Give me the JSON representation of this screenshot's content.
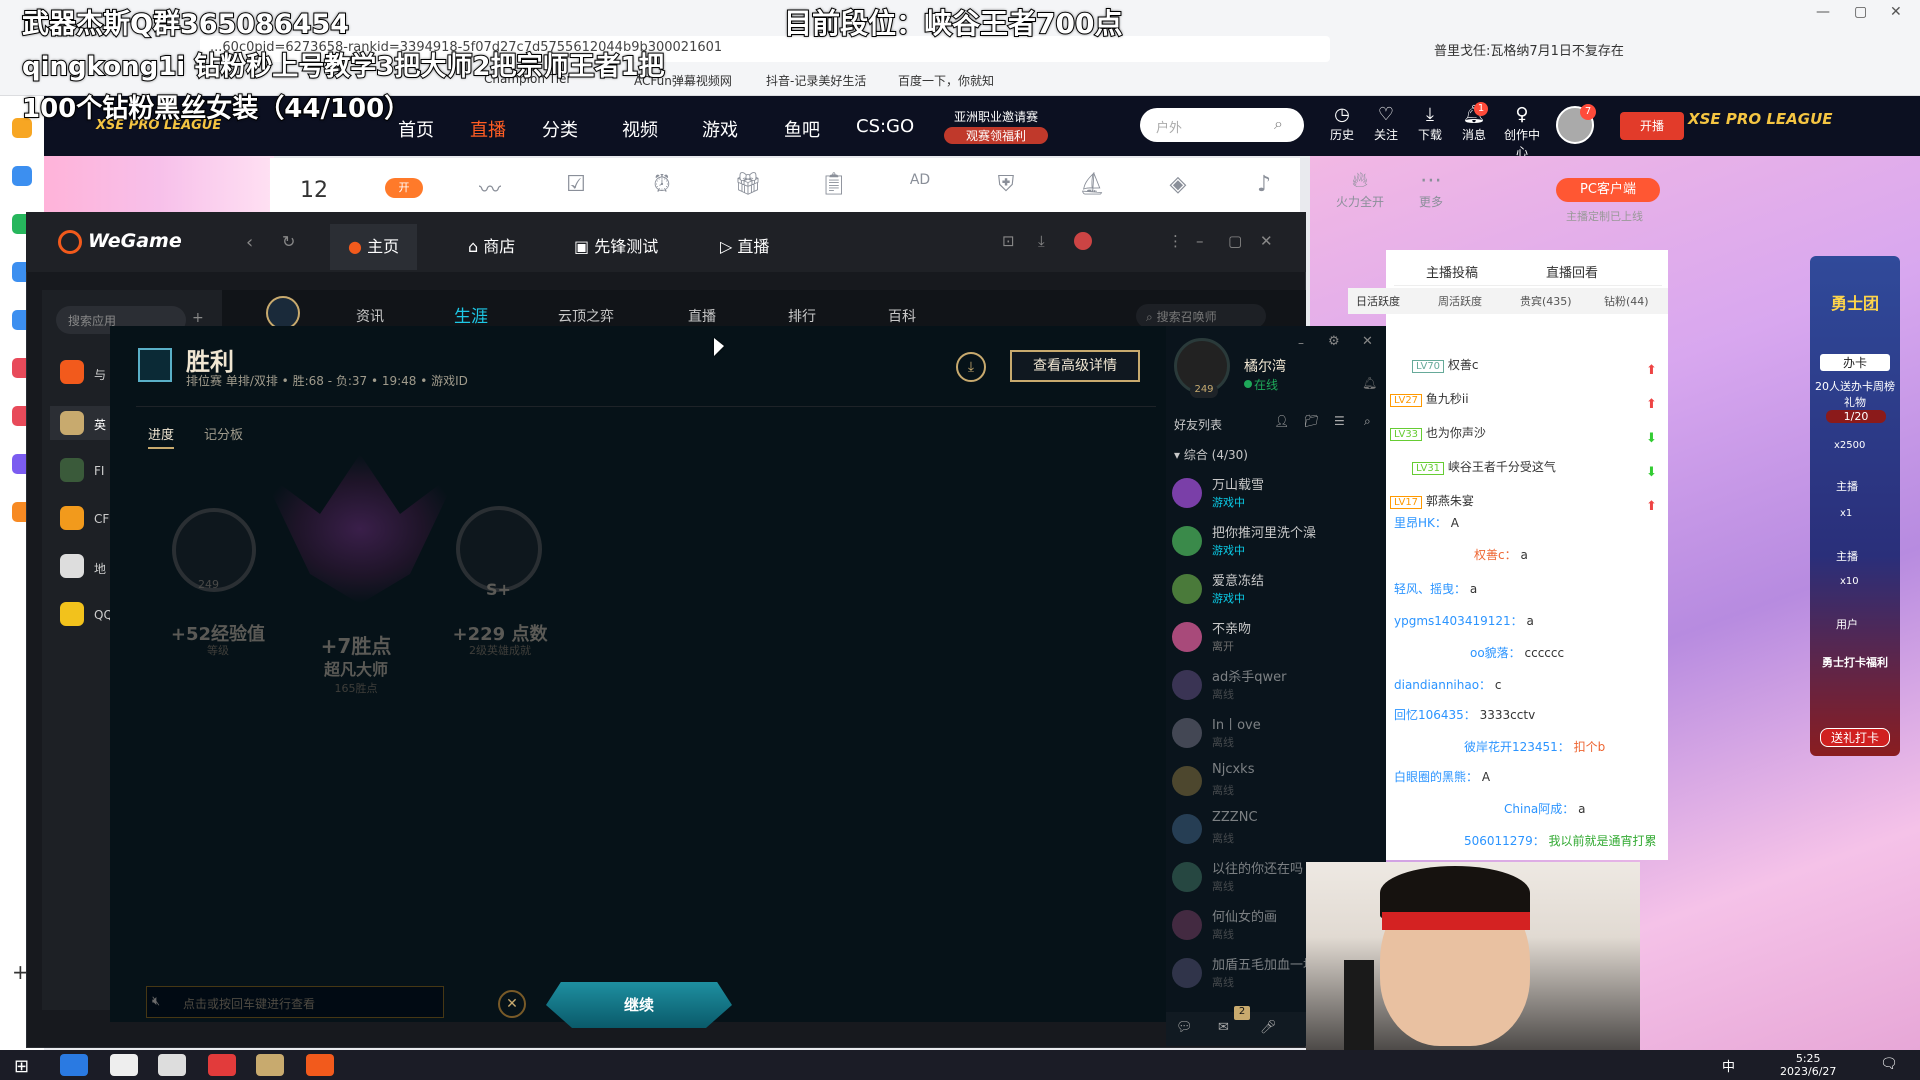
{
  "overlay": {
    "qq_group": "武器杰斯Q群365086454",
    "rank_now": "目前段位：峡谷王者700点",
    "teach": "qingkong1i 钻粉秒上号教学3把大师2把宗师王者1把",
    "progress": "100个钻粉黑丝女装（44/100）"
  },
  "browser": {
    "url": "...60c0pid=6273658-rankid=3394918-5f07d27c7d5755612044b9b300021601",
    "notice": "普里戈任:瓦格纳7月1日不复存在",
    "bookmarks": [
      "Champion Tier",
      "ACFun弹幕视频网",
      "抖音-记录美好生活",
      "百度一下，你就知"
    ]
  },
  "douyu": {
    "nav": [
      "首页",
      "直播",
      "分类",
      "视频",
      "游戏",
      "鱼吧",
      "CS:GO"
    ],
    "promo": [
      "亚洲职业邀请赛",
      "观赛领福利"
    ],
    "search_placeholder": "户外",
    "icons": [
      "历史",
      "关注",
      "下载",
      "消息",
      "创作中心"
    ],
    "msg_badge": "1",
    "avatar_badge": "7",
    "live_btn": "开播",
    "xse_logo": "XSE PRO LEAGUE",
    "anchor_level": "12",
    "tools": [
      "开",
      "",
      "",
      "",
      "",
      "",
      "",
      "AD",
      "",
      "",
      "",
      "",
      ""
    ],
    "fire": "火力全开",
    "more": "更多",
    "pc_client": "PC客户端",
    "custom_note": "主播定制已上线",
    "tabs": [
      "主播投稿",
      "直播回看"
    ],
    "rank_tabs": [
      "日活跃度",
      "周活跃度",
      "贵宾(435)",
      "钻粉(44)"
    ],
    "rank": [
      {
        "lv": "LV70",
        "name": "权善c"
      },
      {
        "lv": "LV27",
        "name": "鱼九秒ii"
      },
      {
        "lv": "LV33",
        "name": "也为你声沙"
      },
      {
        "lv": "LV31",
        "name": "峡谷王者千分受这气"
      },
      {
        "lv": "LV17",
        "name": "郭燕朱宴"
      }
    ],
    "chat": [
      {
        "user": "里昂HK：",
        "msg": "A"
      },
      {
        "user": "权善c：",
        "msg": "a"
      },
      {
        "user": "轻风、摇曳：",
        "msg": "a"
      },
      {
        "user": "ypgms1403419121：",
        "msg": "a"
      },
      {
        "user": "oo貌落：",
        "msg": "cccccc"
      },
      {
        "user": "diandiannihao：",
        "msg": "c"
      },
      {
        "user": "回忆106435：",
        "msg": "3333cctv"
      },
      {
        "user": "彼岸花开123451：",
        "msg": "扣个b"
      },
      {
        "user": "白眼圈的黑熊：",
        "msg": "A"
      },
      {
        "user": "China阿成：",
        "msg": "a"
      },
      {
        "user": "506011279：",
        "msg": "我以前就是通宵打累"
      }
    ],
    "promo_side": [
      "勇士团",
      "办卡",
      "20人送办卡周榜礼物",
      "1/20",
      "x2500",
      "主播",
      "x1",
      "主播",
      "x10",
      "用户",
      "勇士打卡福利",
      "送礼打卡"
    ]
  },
  "wegame": {
    "logo": "WeGame",
    "tabs": [
      "主页",
      "商店",
      "先锋测试",
      "直播"
    ],
    "search": "搜索应用",
    "lol_nav": [
      "资讯",
      "生涯",
      "云顶之弈",
      "直播",
      "排行",
      "百科"
    ],
    "lol_search": "搜索召唤师",
    "apps": [
      "与",
      "英",
      "FI",
      "CF",
      "地",
      "QQ"
    ]
  },
  "postgame": {
    "title": "胜利",
    "sub": "排位赛 单排/双排  •  胜:68 - 负:37  •  19:48  •  游戏ID",
    "advanced": "查看高级详情",
    "tabs": [
      "进度",
      "记分板"
    ],
    "stats": [
      {
        "value": "+52经验值",
        "sub": "等级",
        "badge": "249"
      },
      {
        "value": "+7胜点",
        "title": "超凡大师",
        "sub": "165胜点"
      },
      {
        "value": "+229 点数",
        "sub": "2级英雄成就",
        "badge": "S+"
      }
    ],
    "chat_placeholder": "点击或按回车键进行查看",
    "continue": "继续"
  },
  "friends": {
    "me": "橘尔湾",
    "status": "在线",
    "level": "249",
    "header": "好友列表",
    "group": "综合 (4/30)",
    "list": [
      {
        "name": "万山载雪",
        "status": "游戏中",
        "color": "#7a3fa8"
      },
      {
        "name": "把你推河里洗个澡",
        "status": "游戏中",
        "color": "#3a8a4a"
      },
      {
        "name": "爱意冻结",
        "status": "游戏中",
        "color": "#4a7a3a"
      },
      {
        "name": "不亲吻",
        "status": "离开",
        "color": "#a84a7a"
      },
      {
        "name": "ad杀手qwer",
        "status": "离线",
        "color": "#5a4a7a"
      },
      {
        "name": "In丨ove",
        "status": "离线",
        "color": "#6a6a7a"
      },
      {
        "name": "Njcxks",
        "status": "离线",
        "color": "#7a6a3a"
      },
      {
        "name": "ZZZNC",
        "status": "离线",
        "color": "#3a5a7a"
      },
      {
        "name": "以往的你还在吗",
        "status": "离线",
        "color": "#3a6a5a"
      },
      {
        "name": "何仙女的画",
        "status": "离线",
        "color": "#6a3a5a"
      },
      {
        "name": "加盾五毛加血一块",
        "status": "离线",
        "color": "#4a4a6a"
      }
    ],
    "chat_badge": "2"
  },
  "taskbar": {
    "time": "5:25",
    "date": "2023/6/27",
    "ime": "中"
  }
}
